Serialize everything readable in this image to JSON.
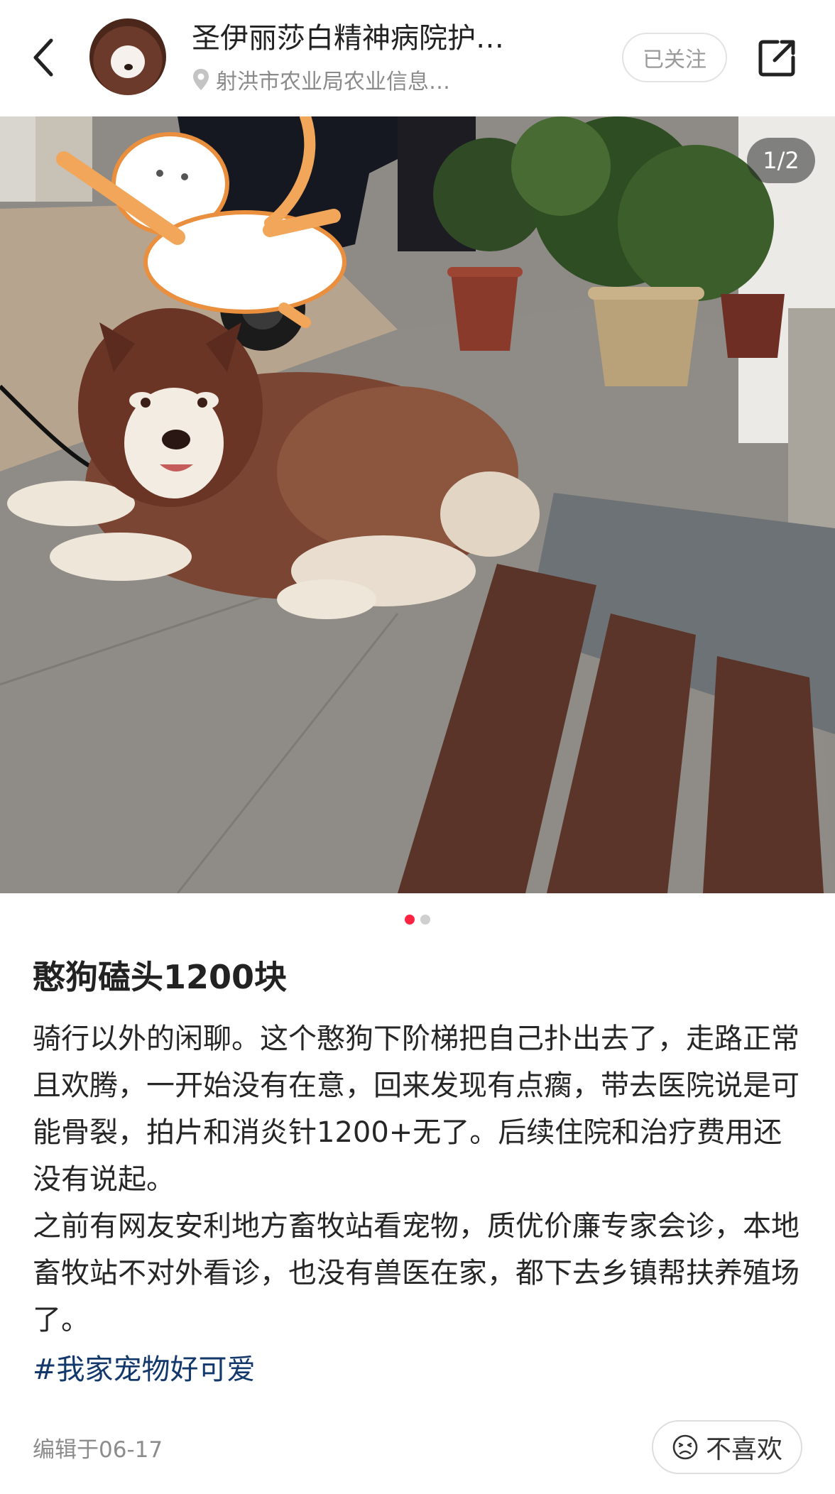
{
  "header": {
    "back_icon": "chevron-left-icon",
    "author_name": "圣伊丽莎白精神病院护…",
    "location": "射洪市农业局农业信息…",
    "follow_label": "已关注",
    "share_icon": "share-icon"
  },
  "gallery": {
    "counter": "1/2",
    "total": 2,
    "active_index": 0
  },
  "post": {
    "title": "憨狗磕头1200块",
    "paragraphs": [
      "骑行以外的闲聊。这个憨狗下阶梯把自己扑出去了，走路正常且欢腾，一开始没有在意，回来发现有点瘸，带去医院说是可能骨裂，拍片和消炎针1200+无了。后续住院和治疗费用还没有说起。",
      "之前有网友安利地方畜牧站看宠物，质优价廉专家会诊，本地畜牧站不对外看诊，也没有兽医在家，都下去乡镇帮扶养殖场了。"
    ],
    "hashtag": "#我家宠物好可爱",
    "edited": "编辑于06-17"
  },
  "actions": {
    "dislike_label": "不喜欢",
    "dislike_icon": "unhappy-face-icon"
  },
  "colors": {
    "accent": "#ff2442",
    "hashtag": "#13386c"
  }
}
